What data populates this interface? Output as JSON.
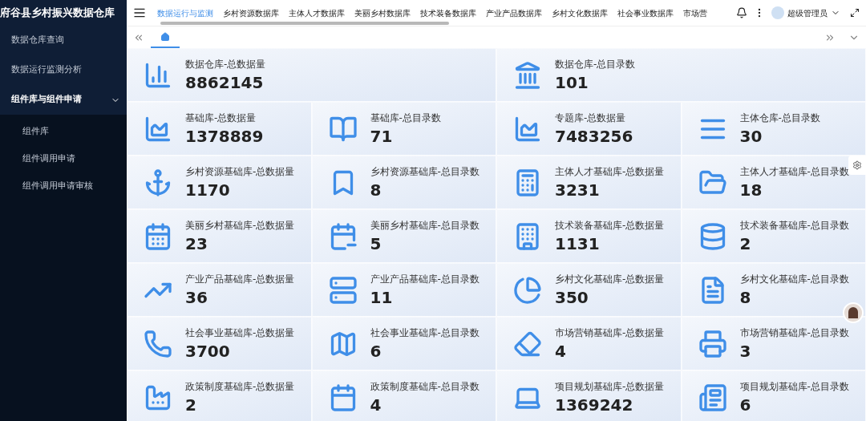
{
  "app_title": "府谷县乡村振兴数据仓库",
  "sidebar": {
    "items": [
      {
        "label": "数据仓库查询",
        "expanded": false
      },
      {
        "label": "数据运行监测分析",
        "expanded": false
      },
      {
        "label": "组件库与组件申请",
        "expanded": true,
        "children": [
          {
            "label": "组件库"
          },
          {
            "label": "组件调用申请"
          },
          {
            "label": "组件调用申请审核"
          }
        ]
      }
    ]
  },
  "nav_tabs": [
    {
      "label": "数据运行与监测",
      "selected": true
    },
    {
      "label": "乡村资源数据库",
      "selected": false
    },
    {
      "label": "主体人才数据库",
      "selected": false
    },
    {
      "label": "美丽乡村数据库",
      "selected": false
    },
    {
      "label": "技术装备数据库",
      "selected": false
    },
    {
      "label": "产业产品数据库",
      "selected": false
    },
    {
      "label": "乡村文化数据库",
      "selected": false
    },
    {
      "label": "社会事业数据库",
      "selected": false
    },
    {
      "label": "市场营",
      "selected": false
    }
  ],
  "user": {
    "name": "超级管理员"
  },
  "summary": [
    {
      "label": "数据仓库-总数据量",
      "value": "8862145"
    },
    {
      "label": "数据仓库-总目录数",
      "value": "101"
    }
  ],
  "cards": [
    {
      "label": "基础库-总数据量",
      "value": "1378889"
    },
    {
      "label": "基础库-总目录数",
      "value": "71"
    },
    {
      "label": "专题库-总数据量",
      "value": "7483256"
    },
    {
      "label": "主体仓库-总目录数",
      "value": "30"
    },
    {
      "label": "乡村资源基础库-总数据量",
      "value": "1170"
    },
    {
      "label": "乡村资源基础库-总目录数",
      "value": "8"
    },
    {
      "label": "主体人才基础库-总数据量",
      "value": "3231"
    },
    {
      "label": "主体人才基础库-总目录数",
      "value": "18"
    },
    {
      "label": "美丽乡村基础库-总数据量",
      "value": "23"
    },
    {
      "label": "美丽乡村基础库-总目录数",
      "value": "5"
    },
    {
      "label": "技术装备基础库-总数据量",
      "value": "1131"
    },
    {
      "label": "技术装备基础库-总目录数",
      "value": "2"
    },
    {
      "label": "产业产品基础库-总数据量",
      "value": "36"
    },
    {
      "label": "产业产品基础库-总目录数",
      "value": "11"
    },
    {
      "label": "乡村文化基础库-总数据量",
      "value": "350"
    },
    {
      "label": "乡村文化基础库-总目录数",
      "value": "8"
    },
    {
      "label": "社会事业基础库-总数据量",
      "value": "3700"
    },
    {
      "label": "社会事业基础库-总目录数",
      "value": "6"
    },
    {
      "label": "市场营销基础库-总数据量",
      "value": "4"
    },
    {
      "label": "市场营销基础库-总目录数",
      "value": "3"
    },
    {
      "label": "政策制度基础库-总数据量",
      "value": "2"
    },
    {
      "label": "政策制度基础库-总目录数",
      "value": "4"
    },
    {
      "label": "项目规划基础库-总数据量",
      "value": "1369242"
    },
    {
      "label": "项目规划基础库-总目录数",
      "value": "6"
    }
  ]
}
